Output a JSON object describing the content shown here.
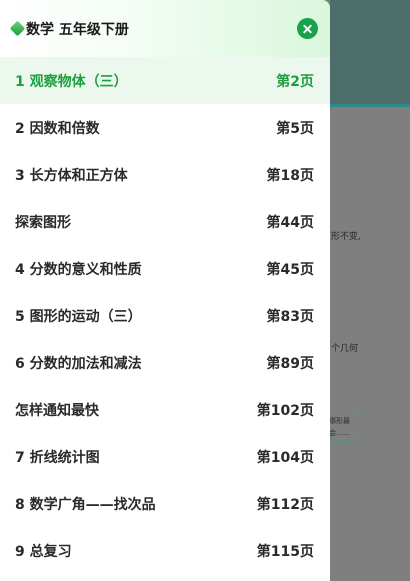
{
  "header": {
    "title": "数学 五年级下册",
    "logo_icon": "leaf-diamond-icon",
    "close_icon": "close-icon"
  },
  "toc": {
    "items": [
      {
        "title": "1 观察物体（三）",
        "page": "第2页",
        "active": true
      },
      {
        "title": "2 因数和倍数",
        "page": "第5页",
        "active": false
      },
      {
        "title": "3 长方体和正方体",
        "page": "第18页",
        "active": false
      },
      {
        "title": "探索图形",
        "page": "第44页",
        "active": false
      },
      {
        "title": "4 分数的意义和性质",
        "page": "第45页",
        "active": false
      },
      {
        "title": "5 图形的运动（三）",
        "page": "第83页",
        "active": false
      },
      {
        "title": "6 分数的加法和减法",
        "page": "第89页",
        "active": false
      },
      {
        "title": "怎样通知最快",
        "page": "第102页",
        "active": false
      },
      {
        "title": "7 折线统计图",
        "page": "第104页",
        "active": false
      },
      {
        "title": "8 数学广角——找次品",
        "page": "第112页",
        "active": false
      },
      {
        "title": "9 总复习",
        "page": "第115页",
        "active": false
      }
    ]
  },
  "background": {
    "text_1": "形不变,",
    "text_2": "个几何",
    "bubble_line_1": "哪形最",
    "bubble_line_2": "会……"
  },
  "colors": {
    "accent": "#1e9e3e",
    "close_button": "#16a34a",
    "active_row": "#ecf8ee",
    "overlay": "#7f7f7f"
  }
}
